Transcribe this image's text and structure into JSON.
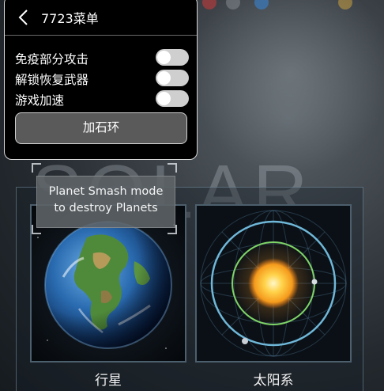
{
  "menu": {
    "title": "7723菜单",
    "options": [
      {
        "label": "免疫部分攻击",
        "enabled": false
      },
      {
        "label": "解锁恢复武器",
        "enabled": false
      },
      {
        "label": "游戏加速",
        "enabled": false
      }
    ],
    "button_label": "加石环"
  },
  "tooltip": {
    "text_line1": "Planet Smash mode",
    "text_line2": "to destroy Planets"
  },
  "background": {
    "title_text": "SOLAR"
  },
  "modes": [
    {
      "label": "行星",
      "icon": "earth-icon"
    },
    {
      "label": "太阳系",
      "icon": "solar-system-icon"
    }
  ],
  "colors": {
    "menu_bg": "#000000",
    "toggle_off": "#cfcfcf",
    "button_bg": "#5a5a5a",
    "sun_core": "#ffd24a",
    "orbit_green": "#7bd66a",
    "orbit_blue": "#6fb7d8"
  }
}
